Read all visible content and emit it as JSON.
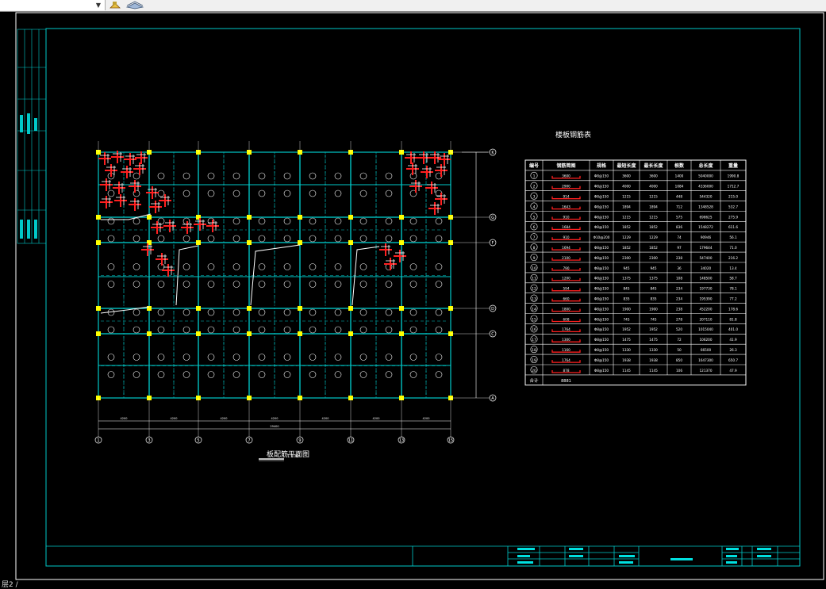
{
  "toolbar": {
    "dropdown_arrow": "▼"
  },
  "drawing": {
    "plan_title": "板配筋平面图",
    "scale_note": "1:100",
    "table_title": "楼板钢筋表",
    "axis_labels_bottom": [
      "1",
      "3",
      "5",
      "7",
      "9",
      "11",
      "13",
      "15"
    ],
    "axis_labels_right": [
      "K",
      "G",
      "F",
      "D",
      "C",
      "A"
    ],
    "bottom_dims": [
      "4200",
      "4200",
      "4200",
      "4200",
      "4200",
      "4200",
      "4200"
    ],
    "total_dim": "29400",
    "table": {
      "headers": [
        "编号",
        "钢筋简图",
        "规格",
        "最短长度",
        "最长长度",
        "根数",
        "总长度",
        "重量"
      ],
      "rows": [
        [
          "1",
          "3600",
          "Φ8@150",
          "3600",
          "3600",
          "1400",
          "5040000",
          "1990.8"
        ],
        [
          "2",
          "2900",
          "Φ8@150",
          "4000",
          "4000",
          "1084",
          "4336000",
          "1712.7"
        ],
        [
          "3",
          "914",
          "Φ8@150",
          "1215",
          "1215",
          "448",
          "544320",
          "215.0"
        ],
        [
          "4",
          "1643",
          "Φ8@150",
          "1894",
          "1894",
          "712",
          "1348528",
          "532.7"
        ],
        [
          "5",
          "910",
          "Φ8@150",
          "1215",
          "1215",
          "575",
          "698625",
          "275.9"
        ],
        [
          "6",
          "1684",
          "Φ8@150",
          "1852",
          "1852",
          "836",
          "1548272",
          "611.6"
        ],
        [
          "7",
          "910",
          "Φ10@200",
          "1229",
          "1229",
          "74",
          "90946",
          "56.1"
        ],
        [
          "8",
          "1694",
          "Φ8@150",
          "1852",
          "1852",
          "97",
          "179644",
          "71.0"
        ],
        [
          "9",
          "2100",
          "Φ8@150",
          "2300",
          "2300",
          "238",
          "547400",
          "216.2"
        ],
        [
          "10",
          "790",
          "Φ8@150",
          "945",
          "945",
          "36",
          "34020",
          "13.4"
        ],
        [
          "11",
          "1200",
          "Φ8@150",
          "1375",
          "1375",
          "108",
          "148500",
          "58.7"
        ],
        [
          "12",
          "594",
          "Φ8@150",
          "845",
          "845",
          "234",
          "197730",
          "78.1"
        ],
        [
          "13",
          "660",
          "Φ8@150",
          "835",
          "835",
          "234",
          "195390",
          "77.2"
        ],
        [
          "14",
          "1800",
          "Φ8@150",
          "1900",
          "1900",
          "238",
          "452200",
          "178.6"
        ],
        [
          "15",
          "608",
          "Φ8@150",
          "745",
          "745",
          "278",
          "207110",
          "81.8"
        ],
        [
          "16",
          "1764",
          "Φ8@150",
          "1952",
          "1952",
          "520",
          "1015040",
          "401.0"
        ],
        [
          "17",
          "1300",
          "Φ8@150",
          "1475",
          "1475",
          "72",
          "106200",
          "41.9"
        ],
        [
          "18",
          "1160",
          "Φ8@150",
          "1330",
          "1330",
          "50",
          "66500",
          "26.3"
        ],
        [
          "19",
          "1764",
          "Φ8@150",
          "1938",
          "1938",
          "850",
          "1647300",
          "650.7"
        ],
        [
          "20",
          "878",
          "Φ8@150",
          "1145",
          "1145",
          "106",
          "121370",
          "47.9"
        ]
      ],
      "total_label": "合计",
      "total_value": "8881"
    }
  },
  "status": {
    "command_text": "层2 /"
  }
}
